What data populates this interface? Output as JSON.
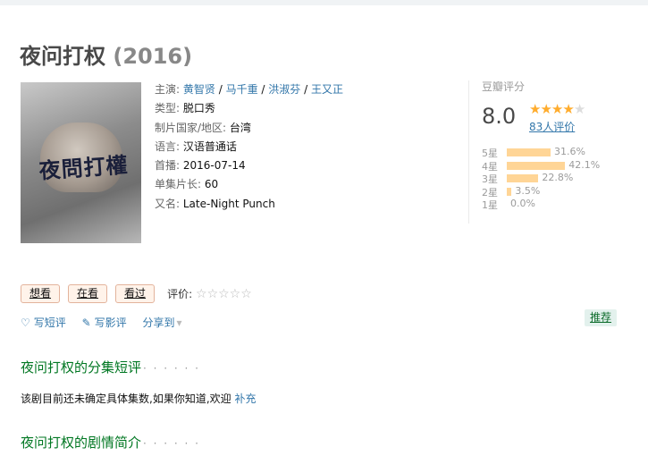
{
  "title": {
    "name": "夜问打权",
    "year": "(2016)"
  },
  "poster": {
    "text": "夜問打權"
  },
  "info": {
    "starring_label": "主演:",
    "starring": [
      "黄智贤",
      "马千重",
      "洪淑芬",
      "王又正"
    ],
    "starring_sep": " / ",
    "genre_label": "类型:",
    "genre": "脱口秀",
    "country_label": "制片国家/地区:",
    "country": "台湾",
    "language_label": "语言:",
    "language": "汉语普通话",
    "premiere_label": "首播:",
    "premiere": "2016-07-14",
    "runtime_label": "单集片长:",
    "runtime": "60",
    "aka_label": "又名:",
    "aka": "Late-Night Punch"
  },
  "rating": {
    "label": "豆瓣评分",
    "score": "8.0",
    "stars": 4,
    "votes": "83人评价",
    "breakdown": [
      {
        "label": "5星",
        "percent": 31.6,
        "text": "31.6%"
      },
      {
        "label": "4星",
        "percent": 42.1,
        "text": "42.1%"
      },
      {
        "label": "3星",
        "percent": 22.8,
        "text": "22.8%"
      },
      {
        "label": "2星",
        "percent": 3.5,
        "text": "3.5%"
      },
      {
        "label": "1星",
        "percent": 0.0,
        "text": "0.0%"
      }
    ],
    "bar_color": "#ffd596",
    "star_color": "#ffac2d"
  },
  "actions": {
    "want": "想看",
    "watching": "在看",
    "watched": "看过",
    "my_rating_label": "评价:",
    "my_stars": "☆☆☆☆☆"
  },
  "tools": {
    "short_review": "写短评",
    "review": "写影评",
    "share": "分享到"
  },
  "recommend": "推荐",
  "sections": {
    "episodes_title": "夜问打权的分集短评",
    "episodes_note": "该剧目前还未确定具体集数,如果你知道,欢迎",
    "episodes_link": "补充",
    "synopsis_title": "夜问打权的剧情简介",
    "dots": "· · · · · ·"
  }
}
